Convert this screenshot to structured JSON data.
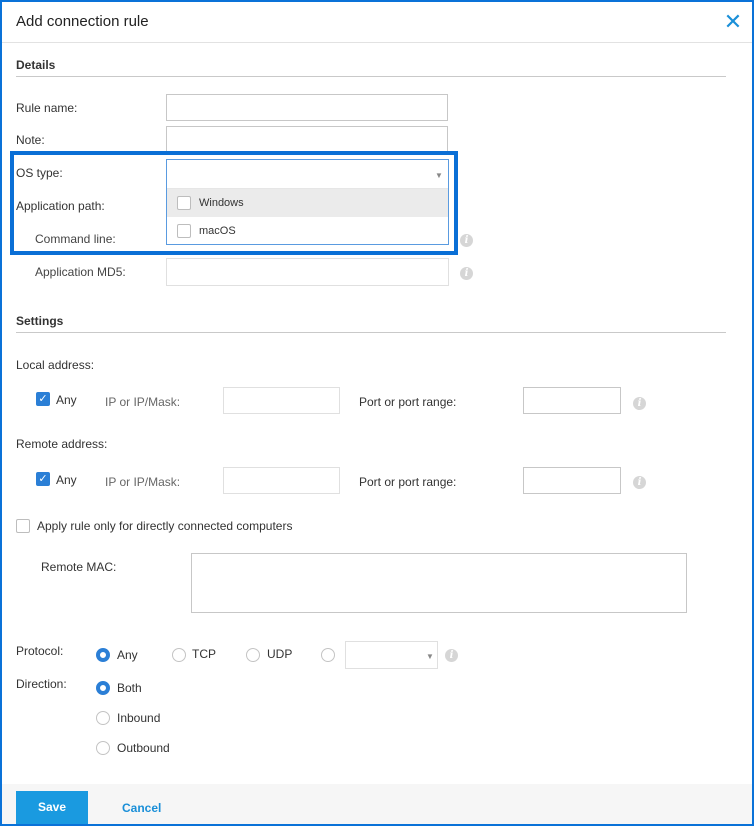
{
  "dialog": {
    "title": "Add connection rule"
  },
  "details": {
    "section_title": "Details",
    "rule_name_label": "Rule name:",
    "rule_name_value": "",
    "note_label": "Note:",
    "note_value": "",
    "os_type_label": "OS type:",
    "os_type_value": "",
    "os_options": [
      "Windows",
      "macOS"
    ],
    "app_path_label": "Application path:",
    "command_line_label": "Command line:",
    "app_md5_label": "Application MD5:"
  },
  "settings": {
    "section_title": "Settings",
    "local_address_label": "Local address:",
    "remote_address_label": "Remote address:",
    "any_label": "Any",
    "ip_mask_label": "IP or IP/Mask:",
    "port_label": "Port or port range:",
    "apply_direct_label": "Apply rule only for directly connected computers",
    "remote_mac_label": "Remote MAC:",
    "protocol_label": "Protocol:",
    "protocol_options": [
      "Any",
      "TCP",
      "UDP"
    ],
    "protocol_selected": "Any",
    "direction_label": "Direction:",
    "direction_options": [
      "Both",
      "Inbound",
      "Outbound"
    ],
    "direction_selected": "Both"
  },
  "footer": {
    "save_label": "Save",
    "cancel_label": "Cancel"
  },
  "colors": {
    "accent": "#1a9ae0",
    "highlight_border": "#0a6fd6",
    "checkbox_on": "#2b7fd6"
  }
}
